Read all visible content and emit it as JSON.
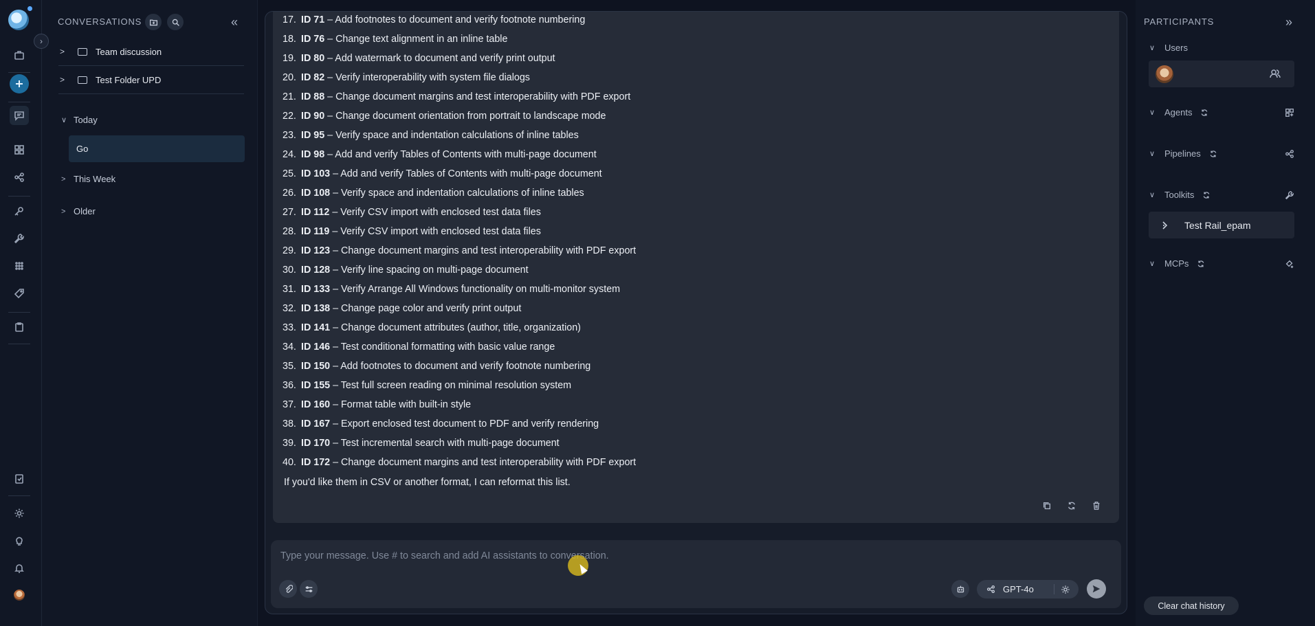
{
  "rail": {
    "icons": [
      "briefcase-icon",
      "plus-icon",
      "chat-icon",
      "grid-icon",
      "flow-icon",
      "key-icon",
      "wrench-icon",
      "apps-icon",
      "tag-icon",
      "clipboard-icon",
      "note-icon",
      "settings-icon",
      "bulb-icon",
      "bell-icon",
      "avatar"
    ]
  },
  "conversations": {
    "header": "CONVERSATIONS",
    "folders": [
      {
        "label": "Team discussion"
      },
      {
        "label": "Test Folder UPD"
      }
    ],
    "groups": {
      "today": "Today",
      "this_week": "This Week",
      "older": "Older"
    },
    "selected_item": "Go"
  },
  "message": {
    "items": [
      {
        "num": "17.",
        "id": "ID 71",
        "text": " – Add footnotes to document and verify footnote numbering"
      },
      {
        "num": "18.",
        "id": "ID 76",
        "text": " – Change text alignment in an inline table"
      },
      {
        "num": "19.",
        "id": "ID 80",
        "text": " – Add watermark to document and verify print output"
      },
      {
        "num": "20.",
        "id": "ID 82",
        "text": " – Verify interoperability with system file dialogs"
      },
      {
        "num": "21.",
        "id": "ID 88",
        "text": " – Change document margins and test interoperability with PDF export"
      },
      {
        "num": "22.",
        "id": "ID 90",
        "text": " – Change document orientation from portrait to landscape mode"
      },
      {
        "num": "23.",
        "id": "ID 95",
        "text": " – Verify space and indentation calculations of inline tables"
      },
      {
        "num": "24.",
        "id": "ID 98",
        "text": " – Add and verify Tables of Contents with multi-page document"
      },
      {
        "num": "25.",
        "id": "ID 103",
        "text": " – Add and verify Tables of Contents with multi-page document"
      },
      {
        "num": "26.",
        "id": "ID 108",
        "text": " – Verify space and indentation calculations of inline tables"
      },
      {
        "num": "27.",
        "id": "ID 112",
        "text": " – Verify CSV import with enclosed test data files"
      },
      {
        "num": "28.",
        "id": "ID 119",
        "text": " – Verify CSV import with enclosed test data files"
      },
      {
        "num": "29.",
        "id": "ID 123",
        "text": " – Change document margins and test interoperability with PDF export"
      },
      {
        "num": "30.",
        "id": "ID 128",
        "text": " – Verify line spacing on multi-page document"
      },
      {
        "num": "31.",
        "id": "ID 133",
        "text": " – Verify Arrange All Windows functionality on multi-monitor system"
      },
      {
        "num": "32.",
        "id": "ID 138",
        "text": " – Change page color and verify print output"
      },
      {
        "num": "33.",
        "id": "ID 141",
        "text": " – Change document attributes (author, title, organization)"
      },
      {
        "num": "34.",
        "id": "ID 146",
        "text": " – Test conditional formatting with basic value range"
      },
      {
        "num": "35.",
        "id": "ID 150",
        "text": " – Add footnotes to document and verify footnote numbering"
      },
      {
        "num": "36.",
        "id": "ID 155",
        "text": " – Test full screen reading on minimal resolution system"
      },
      {
        "num": "37.",
        "id": "ID 160",
        "text": " – Format table with built-in style"
      },
      {
        "num": "38.",
        "id": "ID 167",
        "text": " – Export enclosed test document to PDF and verify rendering"
      },
      {
        "num": "39.",
        "id": "ID 170",
        "text": " – Test incremental search with multi-page document"
      },
      {
        "num": "40.",
        "id": "ID 172",
        "text": " – Change document margins and test interoperability with PDF export"
      }
    ],
    "footer": "If you'd like them in CSV or another format, I can reformat this list."
  },
  "composer": {
    "placeholder": "Type your message. Use # to search and add AI assistants to conversation.",
    "model": "GPT-4o"
  },
  "participants": {
    "header": "PARTICIPANTS",
    "sections": {
      "users": "Users",
      "agents": "Agents",
      "pipelines": "Pipelines",
      "toolkits": "Toolkits",
      "mcps": "MCPs"
    },
    "toolkit_item": "Test Rail_epam",
    "clear_button": "Clear chat history"
  }
}
